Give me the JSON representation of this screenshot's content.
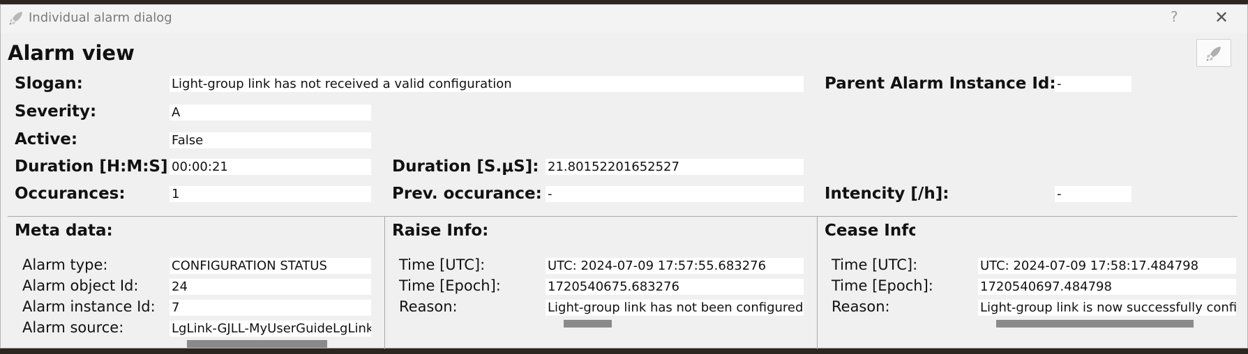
{
  "window": {
    "title": "Individual alarm dialog",
    "help_label": "?",
    "close_label": "✕"
  },
  "header": {
    "title": "Alarm view"
  },
  "summary": {
    "slogan_label": "Slogan:",
    "slogan_value": "Light-group link has not received a valid configuration",
    "parent_label": "Parent Alarm Instance Id:",
    "parent_value": "-",
    "severity_label": "Severity:",
    "severity_value": "A",
    "active_label": "Active:",
    "active_value": "False",
    "duration_hms_label": "Duration [H:M:S]:",
    "duration_hms_value": "00:00:21",
    "duration_s_label": "Duration [S.μS]:",
    "duration_s_value": "21.80152201652527",
    "occurances_label": "Occurances:",
    "occurances_value": "1",
    "prev_label": "Prev. occurance:",
    "prev_value": "-",
    "intencity_label": "Intencity [/h]:",
    "intencity_value": "-"
  },
  "meta": {
    "title": "Meta data:",
    "type_label": "Alarm type:",
    "type_value": "CONFIGURATION STATUS",
    "object_label": "Alarm object Id:",
    "object_value": "24",
    "instance_label": "Alarm instance Id:",
    "instance_value": "7",
    "source_label": "Alarm source:",
    "source_value": "LgLink-GJLL-MyUserGuideLgLinkI"
  },
  "raise": {
    "title": "Raise Info:",
    "utc_label": "Time [UTC]:",
    "utc_value": "UTC: 2024-07-09 17:57:55.683276",
    "epoch_label": "Time [Epoch]:",
    "epoch_value": "1720540675.683276",
    "reason_label": "Reason:",
    "reason_value": "Light-group link has not been configured,"
  },
  "cease": {
    "title": "Cease Info:",
    "utc_label": "Time [UTC]:",
    "utc_value": "UTC: 2024-07-09 17:58:17.484798",
    "epoch_label": "Time [Epoch]:",
    "epoch_value": "1720540697.484798",
    "reason_label": "Reason:",
    "reason_value": "Light-group link is now successfully config"
  },
  "icons": {
    "app": "rocket-icon",
    "corner": "rocket-icon",
    "help": "question-icon",
    "close": "close-icon"
  },
  "colors": {
    "background": "#f0f0f0",
    "field": "#ffffff",
    "scrollbar": "#8a8a8a"
  }
}
